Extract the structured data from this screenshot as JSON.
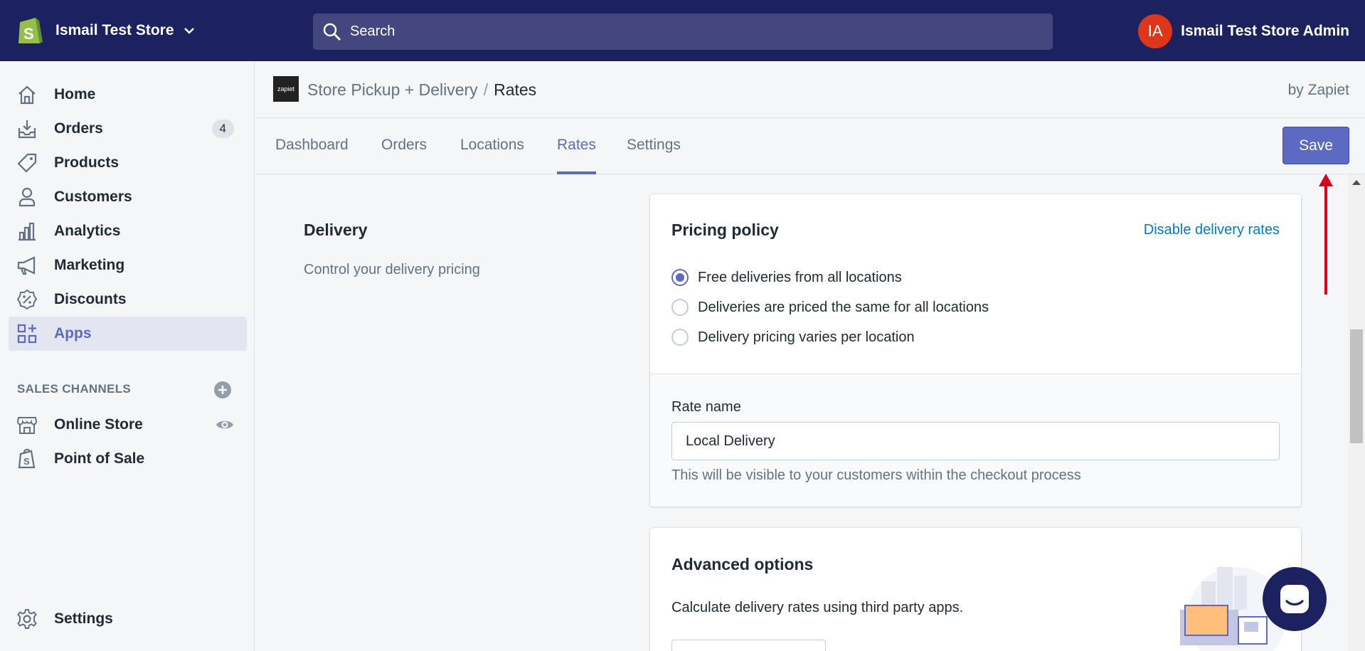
{
  "topbar": {
    "store_name": "Ismail Test Store",
    "search_placeholder": "Search",
    "avatar_initials": "IA",
    "account_name": "Ismail Test Store Admin"
  },
  "sidebar": {
    "items": [
      {
        "label": "Home",
        "icon": "home-icon"
      },
      {
        "label": "Orders",
        "icon": "orders-icon",
        "badge": "4"
      },
      {
        "label": "Products",
        "icon": "tag-icon"
      },
      {
        "label": "Customers",
        "icon": "person-icon"
      },
      {
        "label": "Analytics",
        "icon": "bar-chart-icon"
      },
      {
        "label": "Marketing",
        "icon": "megaphone-icon"
      },
      {
        "label": "Discounts",
        "icon": "discount-icon"
      },
      {
        "label": "Apps",
        "icon": "apps-icon",
        "active": true
      }
    ],
    "sales_channels_title": "SALES CHANNELS",
    "channels": [
      {
        "label": "Online Store",
        "icon": "store-icon"
      },
      {
        "label": "Point of Sale",
        "icon": "shopping-bag-icon"
      }
    ],
    "settings_label": "Settings"
  },
  "app_header": {
    "logo_text": "zapiet",
    "breadcrumb_parent": "Store Pickup + Delivery",
    "breadcrumb_separator": "/",
    "breadcrumb_current": "Rates",
    "byline": "by Zapiet"
  },
  "tabs": [
    "Dashboard",
    "Orders",
    "Locations",
    "Rates",
    "Settings"
  ],
  "active_tab": "Rates",
  "save_label": "Save",
  "delivery": {
    "title": "Delivery",
    "description": "Control your delivery pricing"
  },
  "pricing_card": {
    "title": "Pricing policy",
    "action_link": "Disable delivery rates",
    "options": [
      {
        "label": "Free deliveries from all locations",
        "checked": true
      },
      {
        "label": "Deliveries are priced the same for all locations",
        "checked": false
      },
      {
        "label": "Delivery pricing varies per location",
        "checked": false
      }
    ],
    "rate_name_label": "Rate name",
    "rate_name_value": "Local Delivery",
    "rate_name_help": "This will be visible to your customers within the checkout process"
  },
  "advanced_card": {
    "title": "Advanced options",
    "description": "Calculate delivery rates using third party apps."
  },
  "colors": {
    "topbar": "#1c2260",
    "accent": "#5c6ac4",
    "link": "#007ace",
    "avatar": "#de3618",
    "annotation_arrow": "#e0001b"
  }
}
